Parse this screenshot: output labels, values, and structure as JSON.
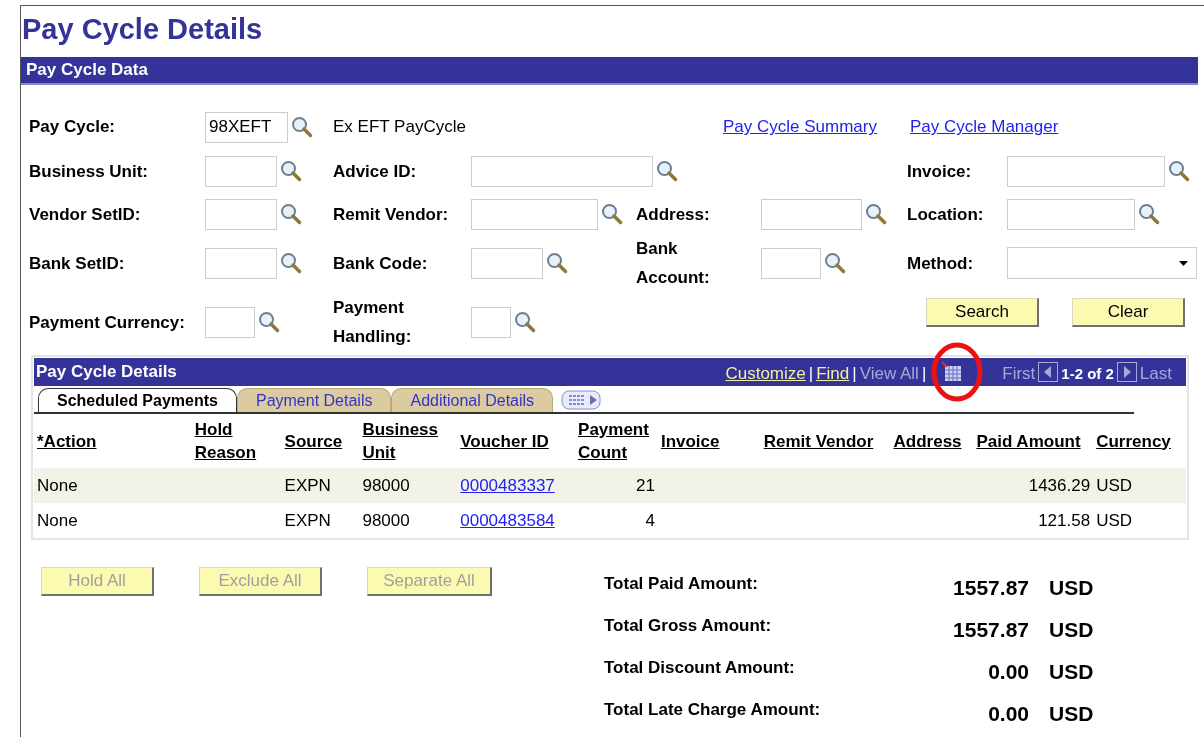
{
  "page_title": "Pay Cycle Details",
  "section_title": "Pay Cycle Data",
  "pay_cycle": {
    "label": "Pay Cycle:",
    "value": "98XEFT",
    "description": "Ex EFT PayCycle"
  },
  "links": [
    "Pay Cycle Summary",
    "Pay Cycle Manager"
  ],
  "fields": [
    {
      "label": "Business Unit:",
      "kind": "lookup"
    },
    {
      "label": "Advice ID:",
      "kind": "lookup"
    },
    {
      "label": "Invoice:",
      "kind": "lookup"
    },
    {
      "label": "Vendor SetID:",
      "kind": "lookup"
    },
    {
      "label": "Remit Vendor:",
      "kind": "lookup"
    },
    {
      "label": "Address:",
      "kind": "lookup"
    },
    {
      "label": "Location:",
      "kind": "lookup"
    },
    {
      "label": "Bank SetID:",
      "kind": "lookup"
    },
    {
      "label": "Bank Code:",
      "kind": "lookup"
    },
    {
      "label": "Bank Account:",
      "kind": "lookup"
    },
    {
      "label": "Method:",
      "kind": "select"
    },
    {
      "label": "Payment Currency:",
      "kind": "lookup"
    },
    {
      "label": "Payment Handling:",
      "kind": "lookup"
    }
  ],
  "buttons": [
    "Search",
    "Clear"
  ],
  "grid": {
    "title": "Pay Cycle Details",
    "nav": [
      {
        "text": "Customize",
        "kind": "link"
      },
      {
        "text": "|",
        "kind": "separator"
      },
      {
        "text": "Find",
        "kind": "link"
      },
      {
        "text": "|",
        "kind": "separator"
      },
      {
        "text": "View All",
        "kind": "disabled"
      },
      {
        "text": "|",
        "kind": "separator"
      },
      {
        "kind": "grid-icon"
      }
    ],
    "pagination": {
      "first": "First",
      "range": "1-2 of 2",
      "last": "Last"
    },
    "tabs": [
      {
        "label": "Scheduled Payments",
        "selected": true
      },
      {
        "label": "Payment Details",
        "selected": false
      },
      {
        "label": "Additional Details",
        "selected": false
      }
    ],
    "columns": [
      {
        "label": "*Action",
        "kind": "text"
      },
      {
        "label": "Hold Reason",
        "kind": "text"
      },
      {
        "label": "Source",
        "kind": "text"
      },
      {
        "label": "Business Unit",
        "kind": "text"
      },
      {
        "label": "Voucher ID",
        "kind": "link"
      },
      {
        "label": "Payment Count",
        "kind": "number"
      },
      {
        "label": "Invoice",
        "kind": "text"
      },
      {
        "label": "Remit Vendor",
        "kind": "text"
      },
      {
        "label": "Address",
        "kind": "text"
      },
      {
        "label": "Paid Amount",
        "kind": "number"
      },
      {
        "label": "Currency",
        "kind": "text"
      }
    ],
    "rows": [
      [
        "None",
        "",
        "EXPN",
        "98000",
        "0000483337",
        "21",
        "",
        "",
        "",
        "1436.29",
        "USD"
      ],
      [
        "None",
        "",
        "EXPN",
        "98000",
        "0000483584",
        "4",
        "",
        "",
        "",
        "121.58",
        "USD"
      ]
    ]
  },
  "row_buttons": [
    {
      "label": "Hold All",
      "disabled": true
    },
    {
      "label": "Exclude All",
      "disabled": true
    },
    {
      "label": "Separate All",
      "disabled": true
    }
  ],
  "totals": [
    {
      "label": "Total Paid Amount:",
      "amount": "1557.87",
      "currency": "USD"
    },
    {
      "label": "Total Gross Amount:",
      "amount": "1557.87",
      "currency": "USD"
    },
    {
      "label": "Total Discount Amount:",
      "amount": "0.00",
      "currency": "USD"
    },
    {
      "label": "Total Late Charge Amount:",
      "amount": "0.00",
      "currency": "USD"
    }
  ]
}
